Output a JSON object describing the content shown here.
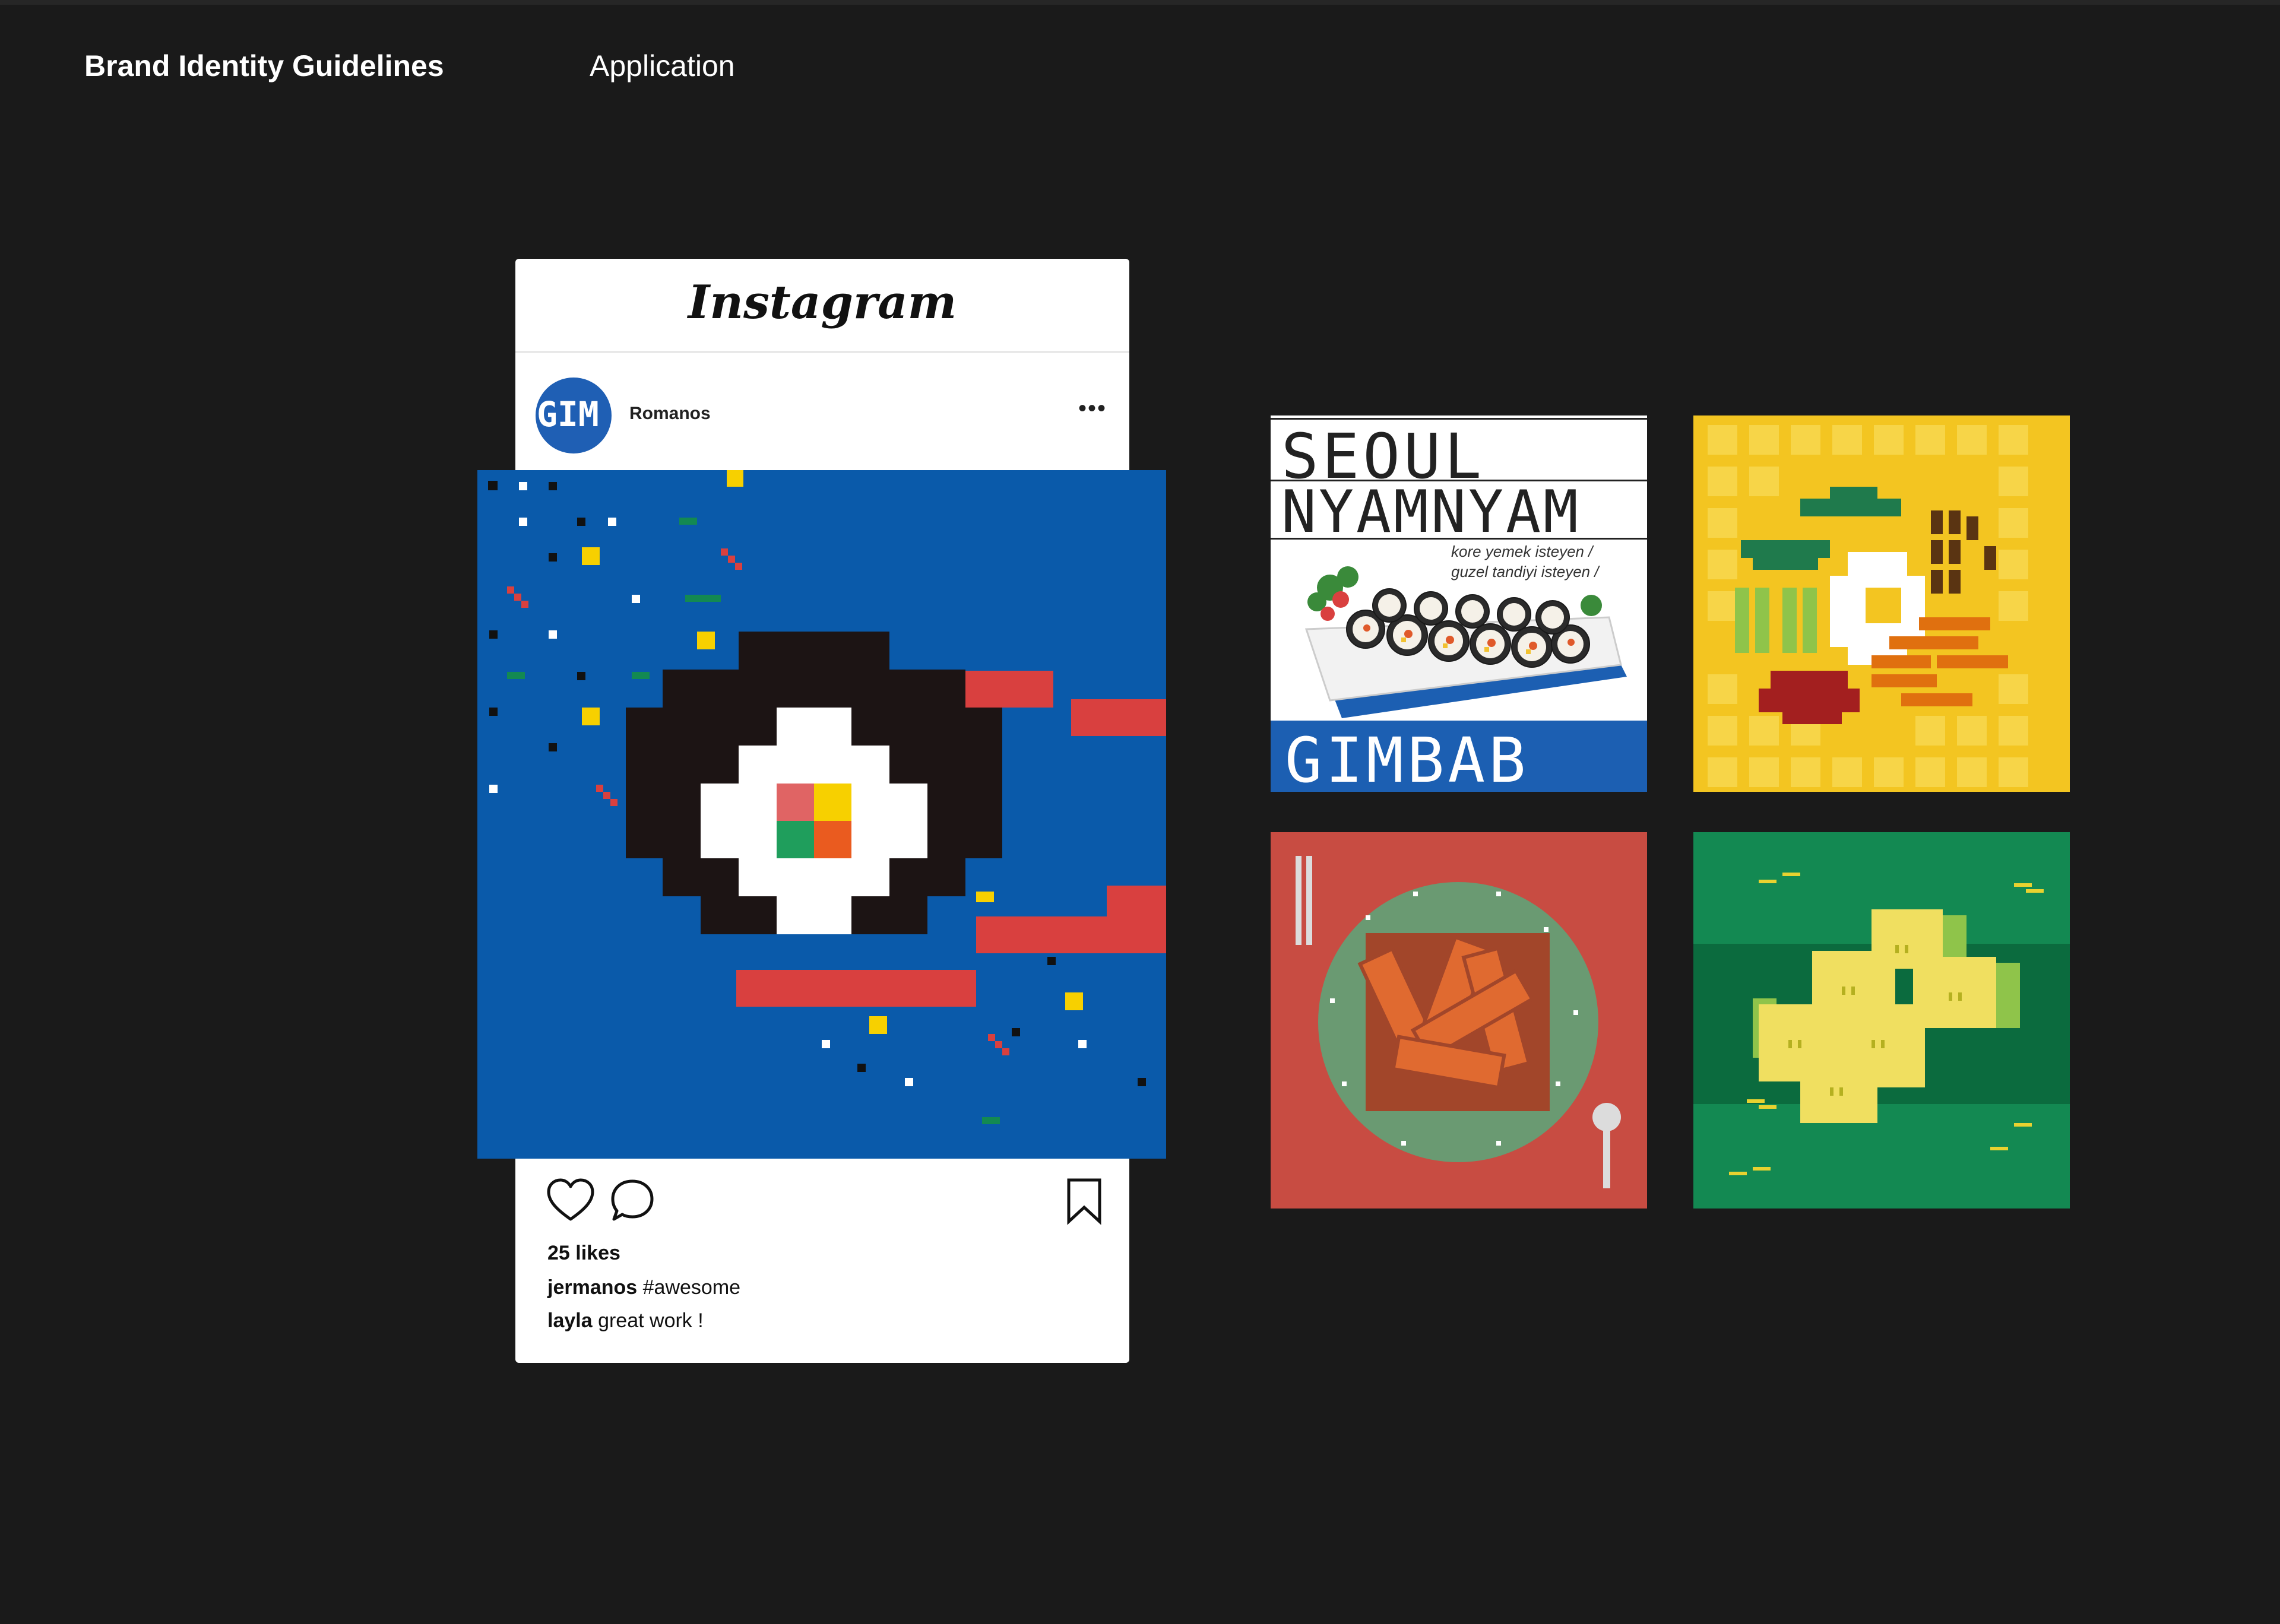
{
  "header": {
    "title": "Brand Identity Guidelines",
    "section": "Application"
  },
  "instagram": {
    "logo_text": "Instagram",
    "avatar_text": "GIM",
    "username": "Romanos",
    "more_icon": "ellipsis-icon",
    "likes": "25 likes",
    "captions": [
      {
        "user": "jermanos",
        "text": "#awesome"
      },
      {
        "user": "layla",
        "text": "great work !"
      }
    ],
    "action_icons": [
      "heart-icon",
      "comment-icon",
      "bookmark-icon"
    ]
  },
  "tiles": {
    "seoul": {
      "line1": "SEOUL",
      "line2": "NYAMNYAM",
      "tagline1": "kore yemek isteyen /",
      "tagline2": "guzel tandiyi isteyen /",
      "product": "GIMBAB"
    }
  },
  "colors": {
    "background": "#1a1a1a",
    "brand_blue": "#0a5aaa",
    "brand_red": "#d9403f",
    "brand_yellow": "#f3c521",
    "brand_green": "#138952"
  }
}
